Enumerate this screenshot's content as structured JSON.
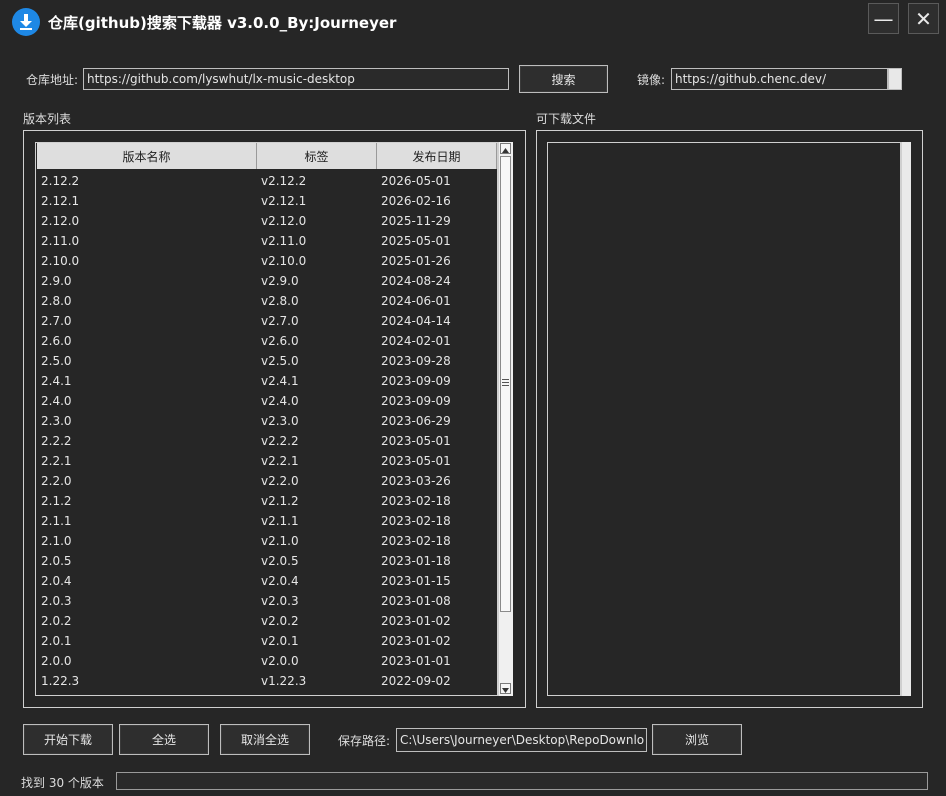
{
  "window": {
    "title": "仓库(github)搜索下载器 v3.0.0_By:Journeyer",
    "minimize_glyph": "—",
    "close_glyph": "✕",
    "icon": "download-icon",
    "accent": "#1e88e5"
  },
  "search": {
    "repo_label": "仓库地址:",
    "repo_value": "https://github.com/lyswhut/lx-music-desktop",
    "search_button": "搜索",
    "mirror_label": "镜像:",
    "mirror_value": "https://github.chenc.dev/"
  },
  "versions": {
    "group_label": "版本列表",
    "columns": [
      "版本名称",
      "标签",
      "发布日期"
    ],
    "rows": [
      {
        "name": "2.12.2",
        "tag": "v2.12.2",
        "date": "2026-05-01"
      },
      {
        "name": "2.12.1",
        "tag": "v2.12.1",
        "date": "2026-02-16"
      },
      {
        "name": "2.12.0",
        "tag": "v2.12.0",
        "date": "2025-11-29"
      },
      {
        "name": "2.11.0",
        "tag": "v2.11.0",
        "date": "2025-05-01"
      },
      {
        "name": "2.10.0",
        "tag": "v2.10.0",
        "date": "2025-01-26"
      },
      {
        "name": "2.9.0",
        "tag": "v2.9.0",
        "date": "2024-08-24"
      },
      {
        "name": "2.8.0",
        "tag": "v2.8.0",
        "date": "2024-06-01"
      },
      {
        "name": "2.7.0",
        "tag": "v2.7.0",
        "date": "2024-04-14"
      },
      {
        "name": "2.6.0",
        "tag": "v2.6.0",
        "date": "2024-02-01"
      },
      {
        "name": "2.5.0",
        "tag": "v2.5.0",
        "date": "2023-09-28"
      },
      {
        "name": "2.4.1",
        "tag": "v2.4.1",
        "date": "2023-09-09"
      },
      {
        "name": "2.4.0",
        "tag": "v2.4.0",
        "date": "2023-09-09"
      },
      {
        "name": "2.3.0",
        "tag": "v2.3.0",
        "date": "2023-06-29"
      },
      {
        "name": "2.2.2",
        "tag": "v2.2.2",
        "date": "2023-05-01"
      },
      {
        "name": "2.2.1",
        "tag": "v2.2.1",
        "date": "2023-05-01"
      },
      {
        "name": "2.2.0",
        "tag": "v2.2.0",
        "date": "2023-03-26"
      },
      {
        "name": "2.1.2",
        "tag": "v2.1.2",
        "date": "2023-02-18"
      },
      {
        "name": "2.1.1",
        "tag": "v2.1.1",
        "date": "2023-02-18"
      },
      {
        "name": "2.1.0",
        "tag": "v2.1.0",
        "date": "2023-02-18"
      },
      {
        "name": "2.0.5",
        "tag": "v2.0.5",
        "date": "2023-01-18"
      },
      {
        "name": "2.0.4",
        "tag": "v2.0.4",
        "date": "2023-01-15"
      },
      {
        "name": "2.0.3",
        "tag": "v2.0.3",
        "date": "2023-01-08"
      },
      {
        "name": "2.0.2",
        "tag": "v2.0.2",
        "date": "2023-01-02"
      },
      {
        "name": "2.0.1",
        "tag": "v2.0.1",
        "date": "2023-01-02"
      },
      {
        "name": "2.0.0",
        "tag": "v2.0.0",
        "date": "2023-01-01"
      },
      {
        "name": "1.22.3",
        "tag": "v1.22.3",
        "date": "2022-09-02"
      }
    ]
  },
  "files": {
    "group_label": "可下载文件"
  },
  "actions": {
    "start_download": "开始下载",
    "select_all": "全选",
    "deselect_all": "取消全选",
    "save_path_label": "保存路径:",
    "save_path_value": "C:\\Users\\Journeyer\\Desktop\\RepoDownlo",
    "browse": "浏览"
  },
  "status": {
    "text": "找到 30 个版本",
    "progress": 0
  }
}
